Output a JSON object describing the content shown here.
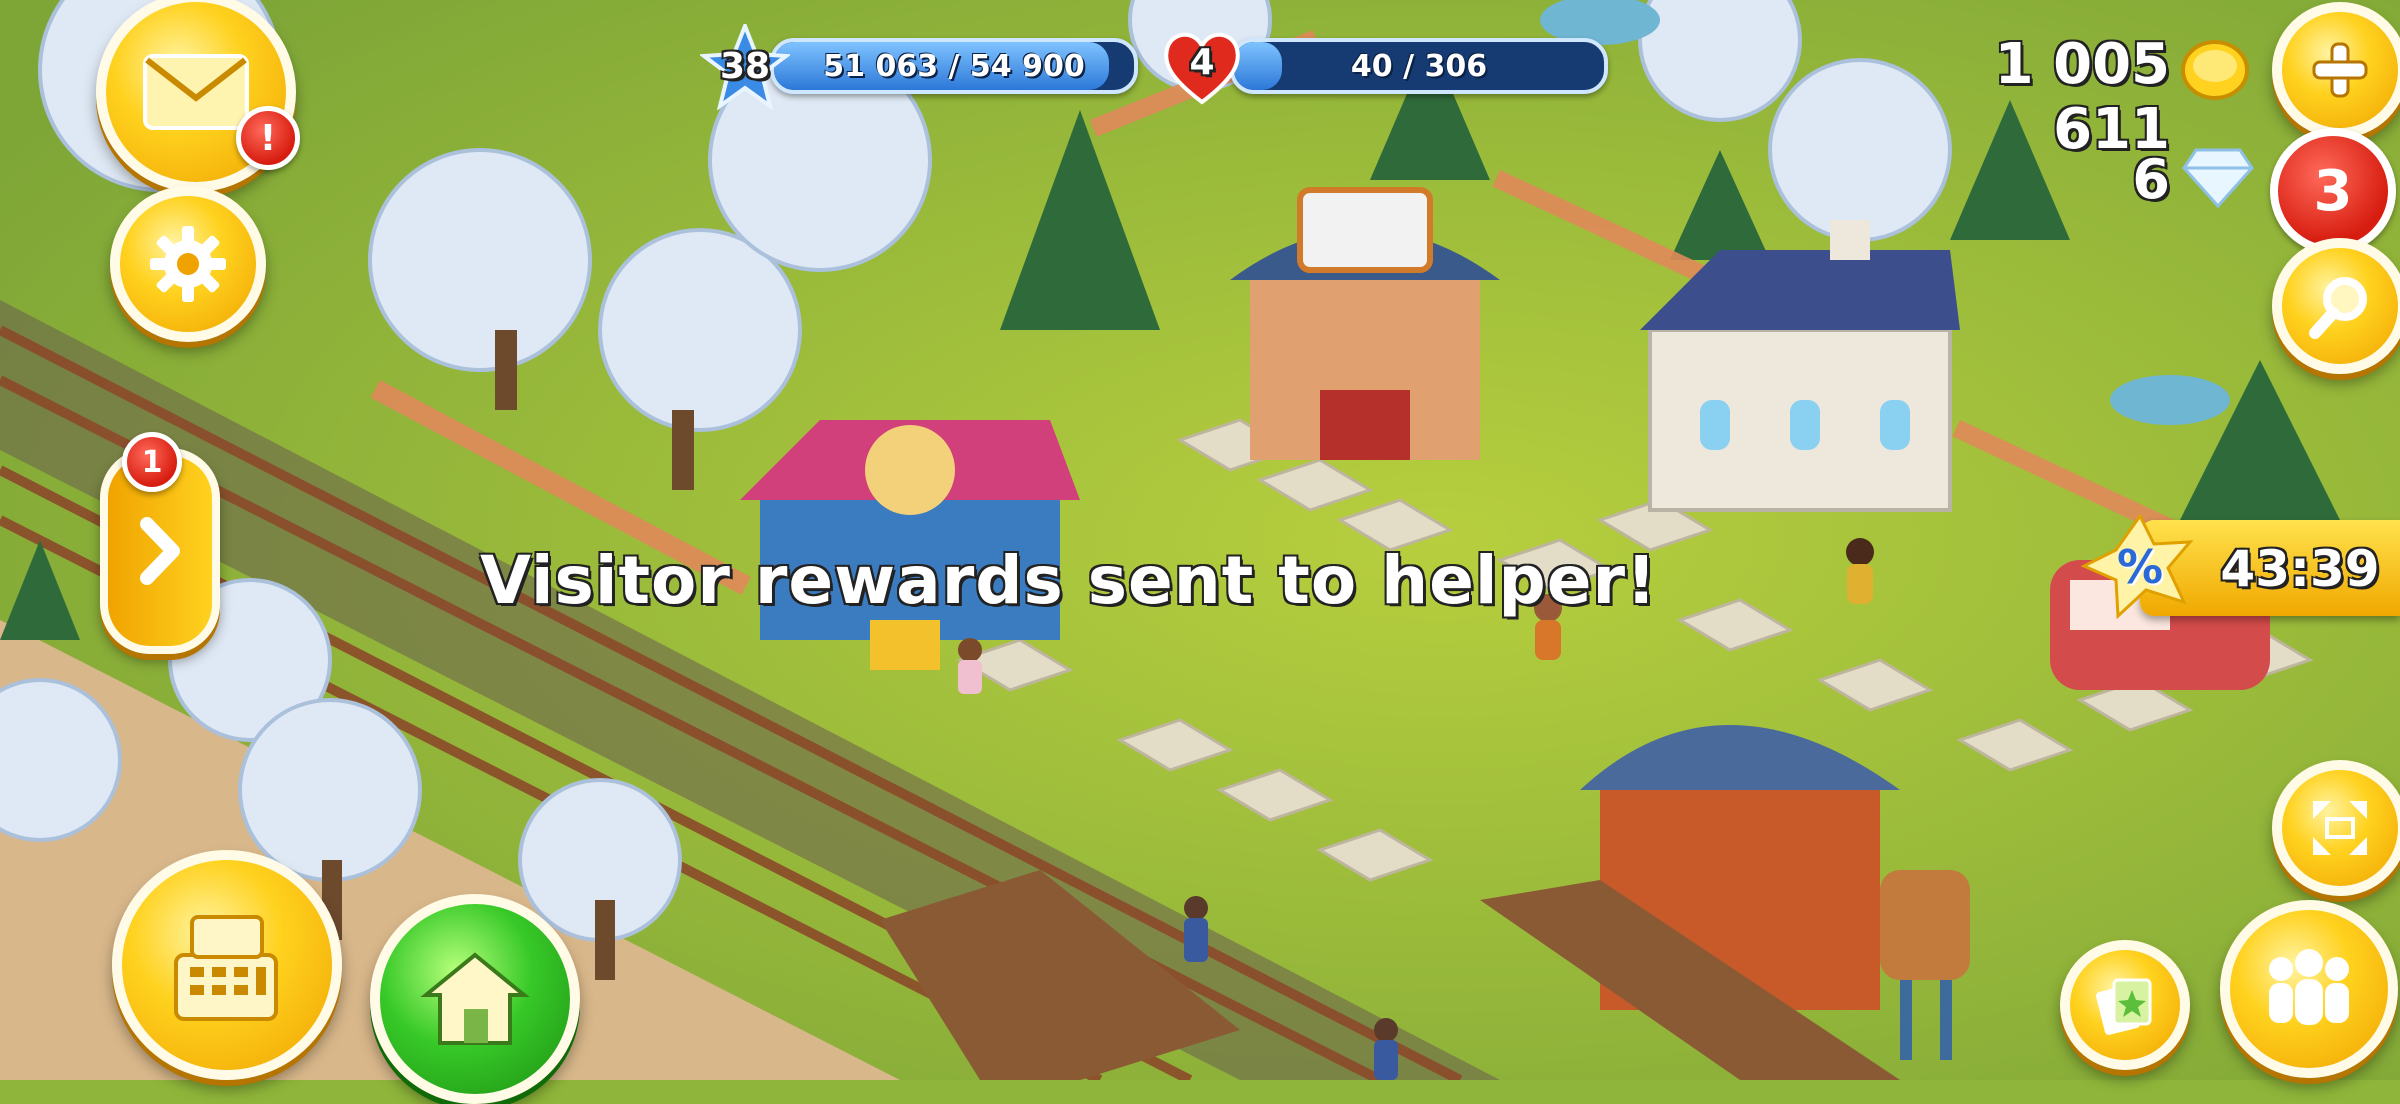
{
  "level": {
    "number": "38",
    "xp_text": "51 063 / 54 900",
    "xp_progress": 0.93
  },
  "reputation": {
    "number": "4",
    "progress_text": "40 / 306",
    "progress": 0.13
  },
  "currency": {
    "coins": "1 005 611",
    "diamonds": "6"
  },
  "mail": {
    "alert": "!"
  },
  "side_arrow": {
    "badge": "1"
  },
  "shop_badge": {
    "count": "3"
  },
  "sale_banner": {
    "text": "43:39",
    "percent_symbol": "%"
  },
  "toast": {
    "message": "Visitor rewards sent to helper!"
  },
  "icons": {
    "mail": "envelope-icon",
    "settings": "gear-icon",
    "side": "chevron-right-icon",
    "shop": "cash-register-icon",
    "home": "house-icon",
    "plus": "plus-icon",
    "search": "magnifier-icon",
    "expand": "expand-arrows-icon",
    "cards": "cards-icon",
    "friends": "friends-icon"
  },
  "colors": {
    "grass": "#8fb63a",
    "accent_gold": "#ffd21f",
    "badge_red": "#d71d10",
    "bar_blue": "#2c78d8"
  }
}
